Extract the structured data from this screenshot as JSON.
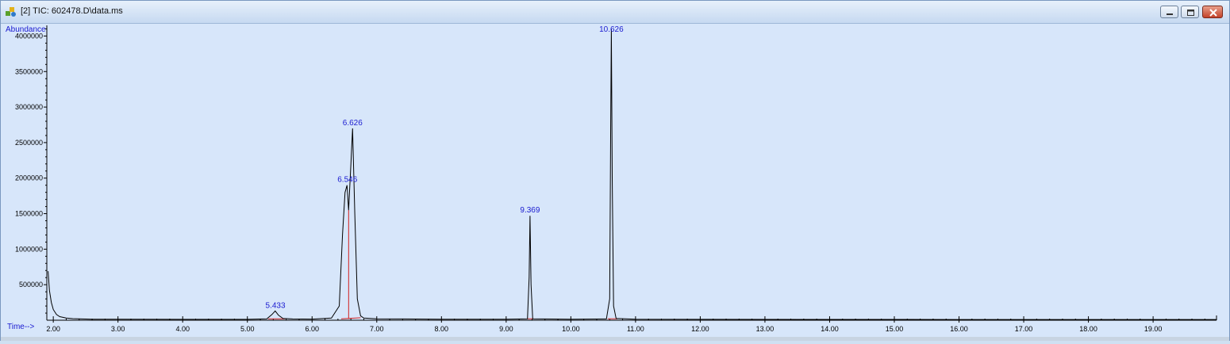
{
  "window": {
    "title": "[2] TIC: 602478.D\\data.ms",
    "buttons": [
      "minimize-icon",
      "maximize-icon",
      "close-icon"
    ],
    "accent": "#1a1ad0"
  },
  "chart_data": {
    "type": "line",
    "ylabel": "Abundance",
    "xlabel": "Time-->",
    "xlim": [
      1.9,
      19.98
    ],
    "ylim": [
      0,
      4150000
    ],
    "x_ticks": [
      "2.00",
      "3.00",
      "4.00",
      "5.00",
      "6.00",
      "7.00",
      "8.00",
      "9.00",
      "10.00",
      "11.00",
      "12.00",
      "13.00",
      "14.00",
      "15.00",
      "16.00",
      "17.00",
      "18.00",
      "19.00"
    ],
    "y_ticks": [
      "500000",
      "1000000",
      "1500000",
      "2000000",
      "2500000",
      "3000000",
      "3500000",
      "4000000"
    ],
    "series": [
      {
        "color": "#000000",
        "x": [
          1.92,
          1.94,
          1.97,
          2.0,
          2.05,
          2.1,
          2.2,
          2.3,
          2.45,
          2.6,
          3.0,
          4.0,
          5.0,
          5.3,
          5.38,
          5.43,
          5.48,
          5.55,
          5.7,
          6.0,
          6.3,
          6.42,
          6.47,
          6.51,
          6.54,
          6.565,
          6.6,
          6.626,
          6.66,
          6.7,
          6.75,
          6.8,
          7.0,
          8.0,
          9.0,
          9.33,
          9.355,
          9.369,
          9.385,
          9.41,
          10.0,
          10.55,
          10.6,
          10.615,
          10.626,
          10.64,
          10.66,
          10.7,
          11.0,
          12.0,
          14.0,
          16.0,
          18.0,
          19.98
        ],
        "y": [
          690000,
          420000,
          250000,
          150000,
          80000,
          50000,
          30000,
          22000,
          18000,
          15000,
          13000,
          12000,
          12000,
          20000,
          80000,
          130000,
          70000,
          25000,
          18000,
          16000,
          30000,
          200000,
          1200000,
          1800000,
          1900000,
          1550000,
          2200000,
          2700000,
          1500000,
          300000,
          60000,
          30000,
          20000,
          15000,
          14000,
          20000,
          600000,
          1470000,
          500000,
          20000,
          15000,
          18000,
          300000,
          2600000,
          4100000,
          2000000,
          200000,
          25000,
          15000,
          12000,
          11000,
          10000,
          10000,
          10000
        ]
      }
    ],
    "integration_color": "#d02020",
    "peaks": [
      {
        "rt": 5.433,
        "label": "5.433",
        "y": 130000
      },
      {
        "rt": 6.546,
        "label": "6.546",
        "y": 1900000
      },
      {
        "rt": 6.626,
        "label": "6.626",
        "y": 2700000
      },
      {
        "rt": 9.369,
        "label": "9.369",
        "y": 1470000
      },
      {
        "rt": 10.626,
        "label": "10.626",
        "y": 4100000
      }
    ]
  }
}
